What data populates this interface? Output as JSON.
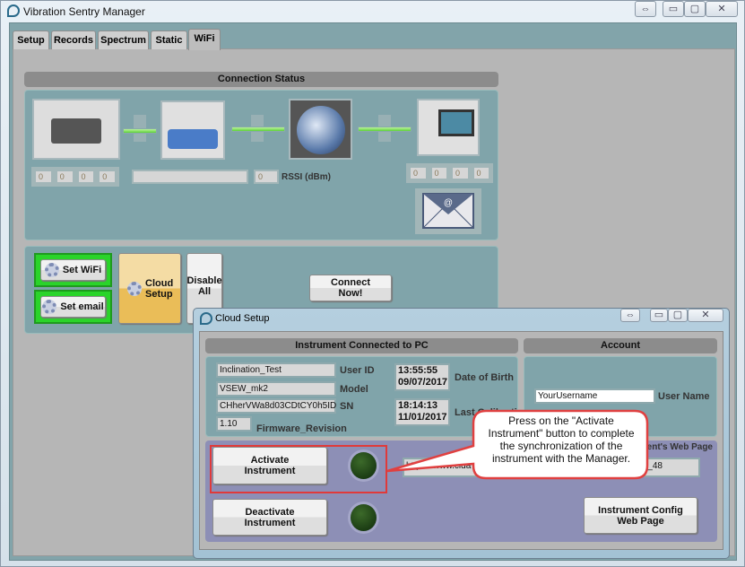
{
  "window": {
    "title": "Vibration Sentry Manager",
    "controls": [
      "⇔",
      "▭",
      "▢",
      "✕"
    ]
  },
  "tabs": [
    {
      "label": "Setup"
    },
    {
      "label": "Records"
    },
    {
      "label": "Spectrum"
    },
    {
      "label": "Static"
    },
    {
      "label": "WiFi",
      "selected": true
    }
  ],
  "connection": {
    "header": "Connection Status",
    "sensor_ip": [
      "0",
      "0",
      "0",
      "0"
    ],
    "ssid": "",
    "rssi_value": "0",
    "rssi_label": "RSSI (dBm)",
    "pc_ip": [
      "0",
      "0",
      "0",
      "0"
    ]
  },
  "buttons": {
    "set_wifi": "Set WiFi",
    "set_email": "Set email",
    "cloud_setup": "Cloud Setup",
    "disable_all": "Disable All",
    "connect_now": "Connect Now!"
  },
  "dialog": {
    "title": "Cloud Setup",
    "controls": [
      "⇔",
      "▭",
      "▢",
      "✕"
    ],
    "instrument_header": "Instrument Connected to PC",
    "account_header": "Account",
    "user_id": {
      "label": "User ID",
      "value": "Inclination_Test"
    },
    "model": {
      "label": "Model",
      "value": "VSEW_mk2"
    },
    "sn": {
      "label": "SN",
      "value": "CHherVWa8d03CDtCY0h5ID"
    },
    "firmware": {
      "label": "Firmware_Revision",
      "value": "1.10"
    },
    "date_of_birth": {
      "label": "Date of Birth",
      "time": "13:55:55",
      "date": "09/07/2017"
    },
    "last_cal": {
      "label": "Last Calibration",
      "time": "18:14:13",
      "date": "11/01/2017"
    },
    "user_name": {
      "label": "User Name",
      "value": "YourUsername"
    },
    "web_page_label": "Instrument's Web Page",
    "url_start": "https://www.cida",
    "url_end": "3/CID_48",
    "activate": "Activate Instrument",
    "deactivate": "Deactivate Instrument",
    "config_web": "Instrument Config Web Page"
  },
  "callout": {
    "text": "Press on the \"Activate Instrument\" button to complete the synchronization of the instrument with the Manager."
  },
  "colors": {
    "teal_panel": "#80a4aa",
    "highlight": "#e03a3a",
    "led_off": "#1e4414",
    "cloud_button": "#eec466",
    "green_button": "#2ad42a"
  }
}
